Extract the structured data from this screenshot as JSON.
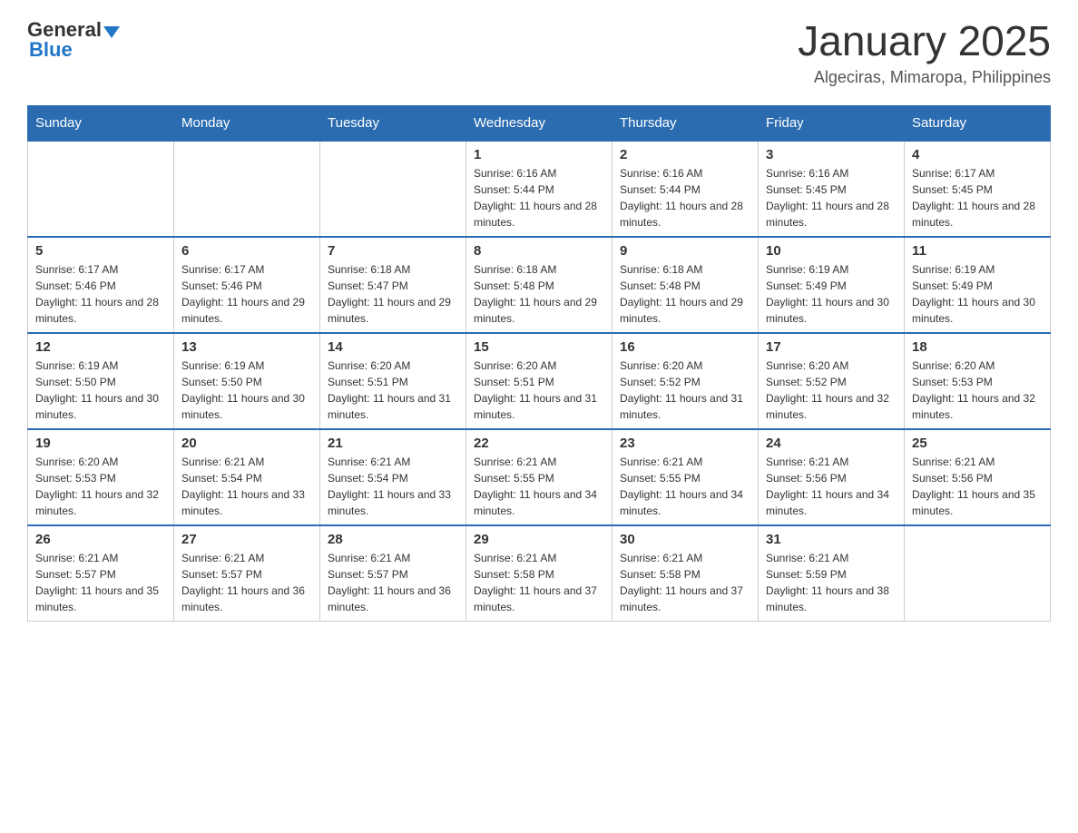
{
  "header": {
    "logo": {
      "general": "General",
      "blue": "Blue"
    },
    "title": "January 2025",
    "subtitle": "Algeciras, Mimaropa, Philippines"
  },
  "days_of_week": [
    "Sunday",
    "Monday",
    "Tuesday",
    "Wednesday",
    "Thursday",
    "Friday",
    "Saturday"
  ],
  "weeks": [
    [
      {
        "day": "",
        "info": ""
      },
      {
        "day": "",
        "info": ""
      },
      {
        "day": "",
        "info": ""
      },
      {
        "day": "1",
        "info": "Sunrise: 6:16 AM\nSunset: 5:44 PM\nDaylight: 11 hours and 28 minutes."
      },
      {
        "day": "2",
        "info": "Sunrise: 6:16 AM\nSunset: 5:44 PM\nDaylight: 11 hours and 28 minutes."
      },
      {
        "day": "3",
        "info": "Sunrise: 6:16 AM\nSunset: 5:45 PM\nDaylight: 11 hours and 28 minutes."
      },
      {
        "day": "4",
        "info": "Sunrise: 6:17 AM\nSunset: 5:45 PM\nDaylight: 11 hours and 28 minutes."
      }
    ],
    [
      {
        "day": "5",
        "info": "Sunrise: 6:17 AM\nSunset: 5:46 PM\nDaylight: 11 hours and 28 minutes."
      },
      {
        "day": "6",
        "info": "Sunrise: 6:17 AM\nSunset: 5:46 PM\nDaylight: 11 hours and 29 minutes."
      },
      {
        "day": "7",
        "info": "Sunrise: 6:18 AM\nSunset: 5:47 PM\nDaylight: 11 hours and 29 minutes."
      },
      {
        "day": "8",
        "info": "Sunrise: 6:18 AM\nSunset: 5:48 PM\nDaylight: 11 hours and 29 minutes."
      },
      {
        "day": "9",
        "info": "Sunrise: 6:18 AM\nSunset: 5:48 PM\nDaylight: 11 hours and 29 minutes."
      },
      {
        "day": "10",
        "info": "Sunrise: 6:19 AM\nSunset: 5:49 PM\nDaylight: 11 hours and 30 minutes."
      },
      {
        "day": "11",
        "info": "Sunrise: 6:19 AM\nSunset: 5:49 PM\nDaylight: 11 hours and 30 minutes."
      }
    ],
    [
      {
        "day": "12",
        "info": "Sunrise: 6:19 AM\nSunset: 5:50 PM\nDaylight: 11 hours and 30 minutes."
      },
      {
        "day": "13",
        "info": "Sunrise: 6:19 AM\nSunset: 5:50 PM\nDaylight: 11 hours and 30 minutes."
      },
      {
        "day": "14",
        "info": "Sunrise: 6:20 AM\nSunset: 5:51 PM\nDaylight: 11 hours and 31 minutes."
      },
      {
        "day": "15",
        "info": "Sunrise: 6:20 AM\nSunset: 5:51 PM\nDaylight: 11 hours and 31 minutes."
      },
      {
        "day": "16",
        "info": "Sunrise: 6:20 AM\nSunset: 5:52 PM\nDaylight: 11 hours and 31 minutes."
      },
      {
        "day": "17",
        "info": "Sunrise: 6:20 AM\nSunset: 5:52 PM\nDaylight: 11 hours and 32 minutes."
      },
      {
        "day": "18",
        "info": "Sunrise: 6:20 AM\nSunset: 5:53 PM\nDaylight: 11 hours and 32 minutes."
      }
    ],
    [
      {
        "day": "19",
        "info": "Sunrise: 6:20 AM\nSunset: 5:53 PM\nDaylight: 11 hours and 32 minutes."
      },
      {
        "day": "20",
        "info": "Sunrise: 6:21 AM\nSunset: 5:54 PM\nDaylight: 11 hours and 33 minutes."
      },
      {
        "day": "21",
        "info": "Sunrise: 6:21 AM\nSunset: 5:54 PM\nDaylight: 11 hours and 33 minutes."
      },
      {
        "day": "22",
        "info": "Sunrise: 6:21 AM\nSunset: 5:55 PM\nDaylight: 11 hours and 34 minutes."
      },
      {
        "day": "23",
        "info": "Sunrise: 6:21 AM\nSunset: 5:55 PM\nDaylight: 11 hours and 34 minutes."
      },
      {
        "day": "24",
        "info": "Sunrise: 6:21 AM\nSunset: 5:56 PM\nDaylight: 11 hours and 34 minutes."
      },
      {
        "day": "25",
        "info": "Sunrise: 6:21 AM\nSunset: 5:56 PM\nDaylight: 11 hours and 35 minutes."
      }
    ],
    [
      {
        "day": "26",
        "info": "Sunrise: 6:21 AM\nSunset: 5:57 PM\nDaylight: 11 hours and 35 minutes."
      },
      {
        "day": "27",
        "info": "Sunrise: 6:21 AM\nSunset: 5:57 PM\nDaylight: 11 hours and 36 minutes."
      },
      {
        "day": "28",
        "info": "Sunrise: 6:21 AM\nSunset: 5:57 PM\nDaylight: 11 hours and 36 minutes."
      },
      {
        "day": "29",
        "info": "Sunrise: 6:21 AM\nSunset: 5:58 PM\nDaylight: 11 hours and 37 minutes."
      },
      {
        "day": "30",
        "info": "Sunrise: 6:21 AM\nSunset: 5:58 PM\nDaylight: 11 hours and 37 minutes."
      },
      {
        "day": "31",
        "info": "Sunrise: 6:21 AM\nSunset: 5:59 PM\nDaylight: 11 hours and 38 minutes."
      },
      {
        "day": "",
        "info": ""
      }
    ]
  ]
}
